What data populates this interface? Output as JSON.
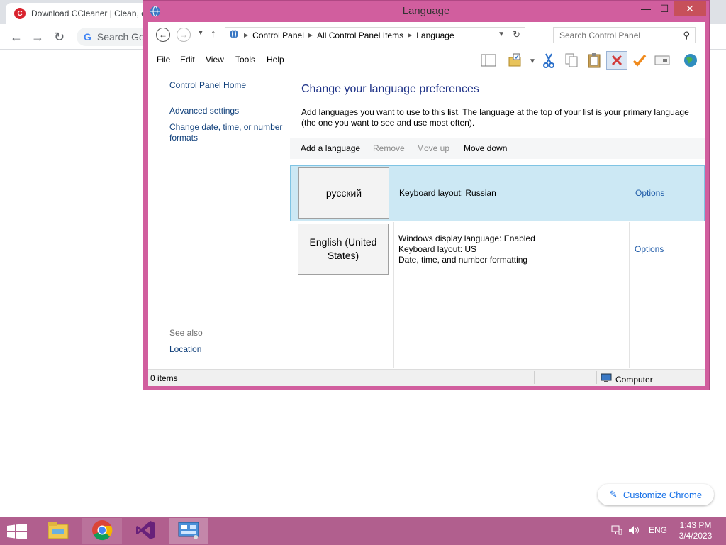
{
  "browser": {
    "tab_title": "Download CCleaner | Clean, o",
    "omnibox_text": "Search Go",
    "customize_label": "Customize Chrome"
  },
  "window": {
    "title": "Language",
    "min_glyph": "—",
    "max_glyph": "☐",
    "close_glyph": "✕"
  },
  "address": {
    "crumbs": [
      "Control Panel",
      "All Control Panel Items",
      "Language"
    ],
    "search_placeholder": "Search Control Panel"
  },
  "menu": [
    "File",
    "Edit",
    "View",
    "Tools",
    "Help"
  ],
  "left_pane": {
    "home": "Control Panel Home",
    "advanced": "Advanced settings",
    "change_formats": "Change date, time, or number formats",
    "see_also": "See also",
    "location": "Location"
  },
  "main": {
    "title": "Change your language preferences",
    "description": "Add languages you want to use to this list. The language at the top of your list is your primary language (the one you want to see and use most often).",
    "commands": {
      "add": "Add a language",
      "remove": "Remove",
      "move_up": "Move up",
      "move_down": "Move down"
    },
    "languages": [
      {
        "name": "русский",
        "details": [
          "Keyboard layout: Russian"
        ],
        "options": "Options",
        "selected": true
      },
      {
        "name": "English (United States)",
        "details": [
          "Windows display language: Enabled",
          "Keyboard layout: US",
          "Date, time, and number formatting"
        ],
        "options": "Options",
        "selected": false
      }
    ]
  },
  "status": {
    "items": "0 items",
    "computer": "Computer"
  },
  "taskbar": {
    "ime": "ENG",
    "time": "1:43 PM",
    "date": "3/4/2023"
  },
  "colors": {
    "window_frame": "#d15e9e",
    "taskbar": "#b15f8e",
    "selection": "#cce8f4",
    "link": "#1e5aa8",
    "heading": "#1e3287"
  }
}
